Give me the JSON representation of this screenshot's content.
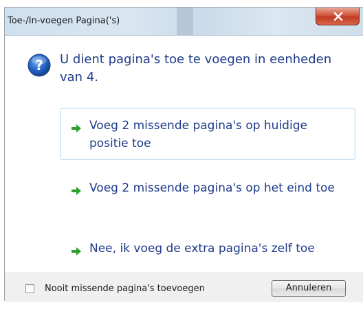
{
  "window": {
    "title": "Toe-/In-voegen Pagina('s)",
    "close_icon": "close-icon"
  },
  "message": {
    "icon": "question-icon",
    "text": "U dient pagina's toe te voegen in eenheden van 4."
  },
  "options": [
    {
      "icon": "green-arrow-icon",
      "label": "Voeg 2 missende pagina's op huidige positie toe",
      "focused": true
    },
    {
      "icon": "green-arrow-icon",
      "label": "Voeg 2 missende pagina's op het eind toe",
      "focused": false
    },
    {
      "icon": "green-arrow-icon",
      "label": "Nee, ik voeg de extra pagina's zelf toe",
      "focused": false
    }
  ],
  "footer": {
    "checkbox_label": "Nooit missende pagina's toevoegen",
    "checkbox_checked": false,
    "cancel_label": "Annuleren"
  },
  "colors": {
    "instruction_text": "#1e3a8a",
    "arrow_green": "#2e9e2e",
    "close_red": "#c03b22"
  }
}
